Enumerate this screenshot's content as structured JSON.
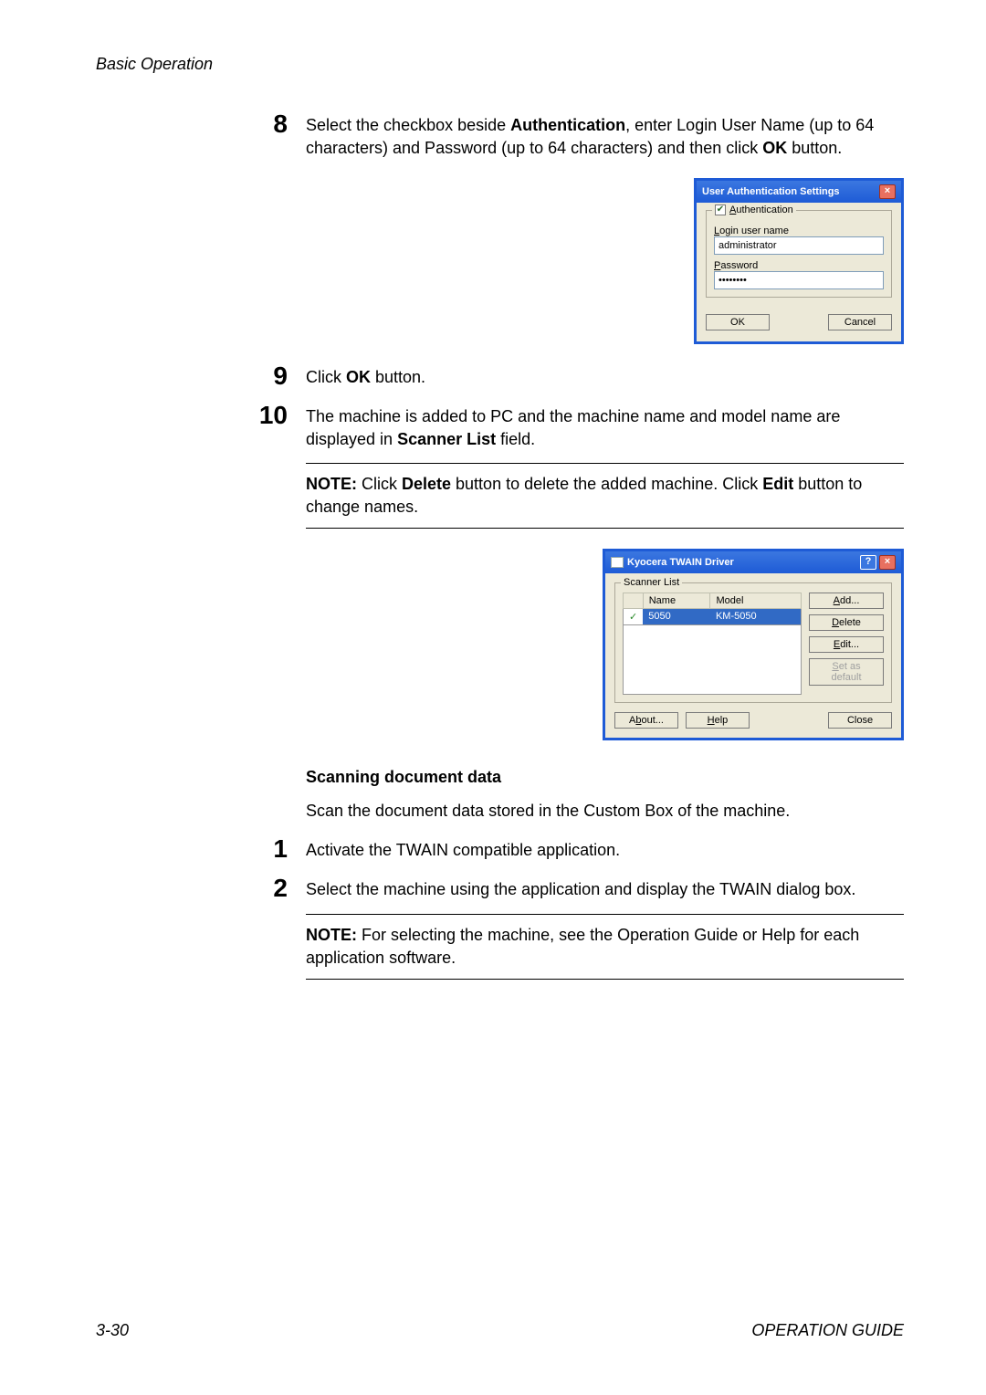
{
  "header": "Basic Operation",
  "steps_a": {
    "n8": {
      "num": "8",
      "text_a": "Select the checkbox beside ",
      "auth": "Authentication",
      "text_b": ", enter Login User Name (up to 64 characters) and Password (up to 64 characters) and then click ",
      "ok": "OK",
      "text_c": " button."
    },
    "n9": {
      "num": "9",
      "text_a": "Click ",
      "ok": "OK",
      "text_b": " button."
    },
    "n10": {
      "num": "10",
      "text_a": "The machine is added to PC and the machine name and model name are displayed in ",
      "sl": "Scanner List",
      "text_b": " field."
    }
  },
  "note1": {
    "label": "NOTE:",
    "text_a": " Click ",
    "del": "Delete",
    "text_b": " button to delete the added machine. Click ",
    "edit": "Edit",
    "text_c": " button to change names."
  },
  "dialog1": {
    "title": "User Authentication Settings",
    "close": "×",
    "group_chk": "✔",
    "group_label": "Authentication",
    "login_label": "Login user name",
    "login_value": "administrator",
    "pwd_label": "Password",
    "pwd_value": "••••••••",
    "ok": "OK",
    "cancel": "Cancel"
  },
  "dialog2": {
    "title": "Kyocera TWAIN Driver",
    "help": "?",
    "close": "×",
    "group": "Scanner List",
    "th_name": "Name",
    "th_model": "Model",
    "row_chk": "✓",
    "row_name": "5050",
    "row_model": "KM-5050",
    "btn_add": "Add...",
    "btn_delete": "Delete",
    "btn_edit": "Edit...",
    "btn_default": "Set as default",
    "btn_about": "About...",
    "btn_help": "Help",
    "btn_close": "Close"
  },
  "sub": "Scanning document data",
  "intro": "Scan the document data stored in the Custom Box of the machine.",
  "steps_b": {
    "n1": {
      "num": "1",
      "text": "Activate the TWAIN compatible application."
    },
    "n2": {
      "num": "2",
      "text": "Select the machine using the application and display the TWAIN dialog box."
    }
  },
  "note2": {
    "label": "NOTE:",
    "text": " For selecting the machine, see the Operation Guide or Help for each application software."
  },
  "footer_left": "3-30",
  "footer_right": "OPERATION GUIDE"
}
